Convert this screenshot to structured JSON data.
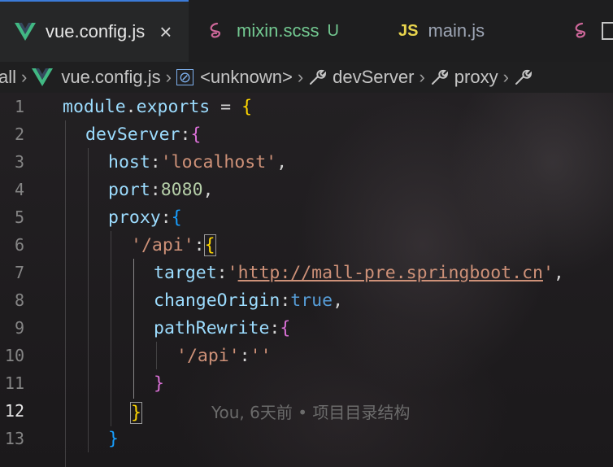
{
  "tabs": [
    {
      "label": "vue.config.js",
      "icon": "vue-icon",
      "active": true,
      "close": "×"
    },
    {
      "label": "mixin.scss",
      "icon": "sass-icon",
      "status": "U"
    },
    {
      "label": "main.js",
      "icon": "js-icon",
      "badge": "JS"
    },
    {
      "icon": "sass-icon"
    }
  ],
  "breadcrumb": {
    "items": [
      "all",
      "vue.config.js",
      "<unknown>",
      "devServer",
      "proxy"
    ]
  },
  "line_numbers": [
    "1",
    "2",
    "3",
    "4",
    "5",
    "6",
    "7",
    "8",
    "9",
    "10",
    "11",
    "12",
    "13"
  ],
  "code": {
    "l1": {
      "a": "module",
      "b": ".",
      "c": "exports",
      "d": " = ",
      "e": "{"
    },
    "l2": {
      "a": "devServer",
      "b": ":",
      "c": "{"
    },
    "l3": {
      "a": "host",
      "b": ":",
      "c": "'localhost'",
      "d": ","
    },
    "l4": {
      "a": "port",
      "b": ":",
      "c": "8080",
      "d": ","
    },
    "l5": {
      "a": "proxy",
      "b": ":",
      "c": "{"
    },
    "l6": {
      "a": "'/api'",
      "b": ":",
      "c": "{"
    },
    "l7": {
      "a": "target",
      "b": ":",
      "c": "'",
      "d": "http://mall-pre.springboot.cn",
      "e": "'",
      "f": ","
    },
    "l8": {
      "a": "changeOrigin",
      "b": ":",
      "c": "true",
      "d": ","
    },
    "l9": {
      "a": "pathRewrite",
      "b": ":",
      "c": "{"
    },
    "l10": {
      "a": "'/api'",
      "b": ":",
      "c": "''"
    },
    "l11": {
      "a": "}"
    },
    "l12": {
      "a": "}",
      "blame": "You, 6天前 • 项目目录结构"
    },
    "l13": {
      "a": "}"
    }
  },
  "colors": {
    "accent": "#3b7bd9",
    "string": "#ce9178",
    "property": "#9cdcfe",
    "number": "#b5cea8",
    "keyword": "#569cd6"
  }
}
